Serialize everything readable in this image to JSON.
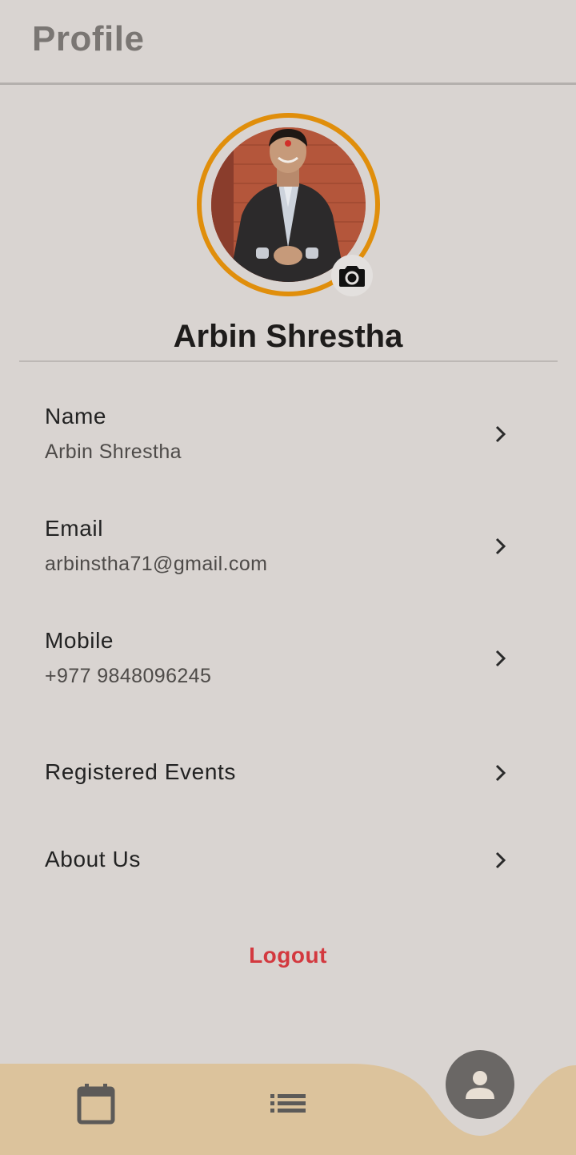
{
  "header": {
    "title": "Profile"
  },
  "profile": {
    "display_name": "Arbin Shrestha",
    "avatar_icon": "user-photo",
    "camera_icon": "camera-icon",
    "ring_color": "#e08e0b"
  },
  "fields": [
    {
      "label": "Name",
      "value": "Arbin Shrestha"
    },
    {
      "label": "Email",
      "value": "arbinstha71@gmail.com"
    },
    {
      "label": "Mobile",
      "value": "+977 9848096245"
    }
  ],
  "links": [
    {
      "label": "Registered Events"
    },
    {
      "label": "About Us"
    }
  ],
  "logout": {
    "label": "Logout",
    "color": "#d3393f"
  },
  "bottom_nav": {
    "items": [
      {
        "icon": "calendar-icon"
      },
      {
        "icon": "list-icon"
      },
      {
        "icon": "person-icon",
        "active": true
      }
    ],
    "background": "#dcc39c"
  }
}
